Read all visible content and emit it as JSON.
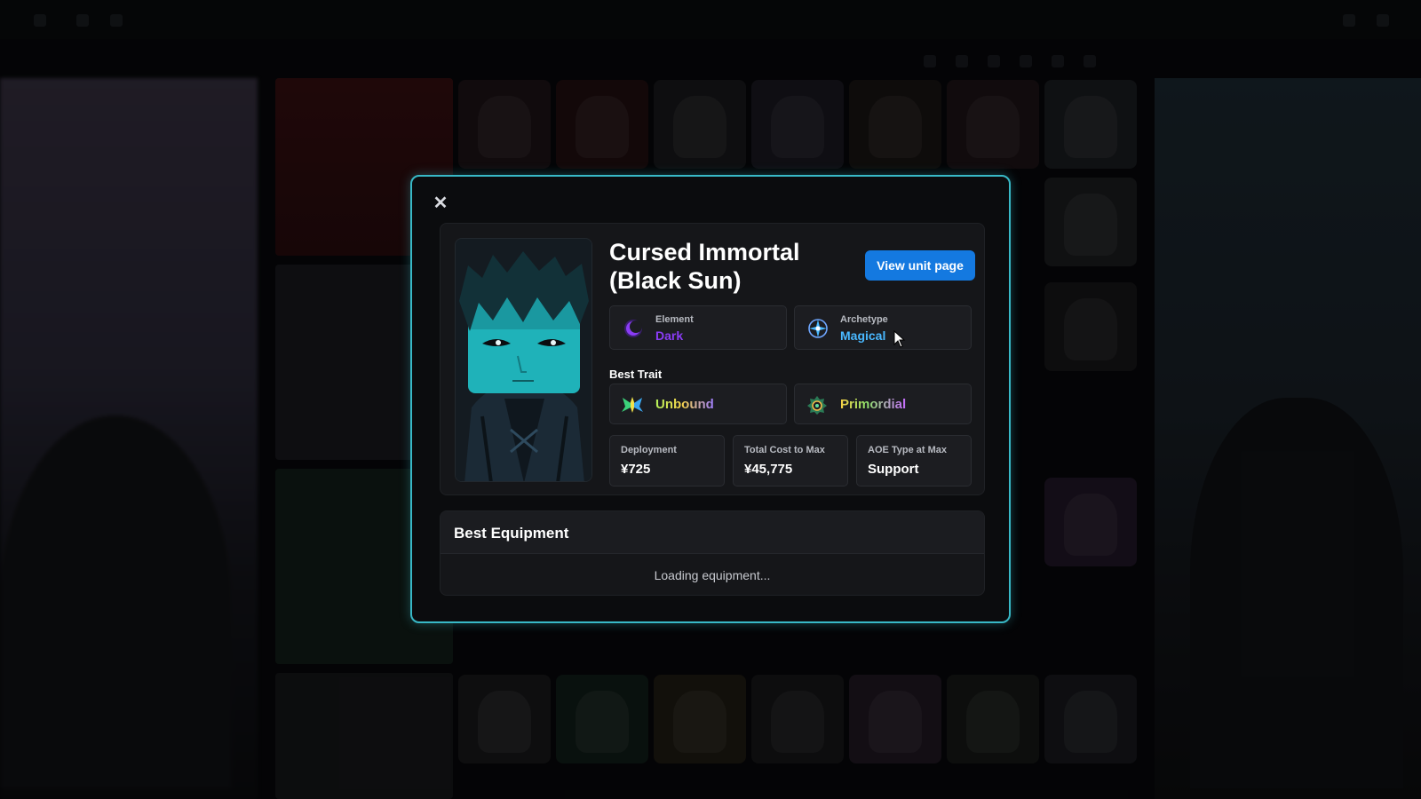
{
  "modal": {
    "close_symbol": "✕",
    "unit": {
      "name": "Cursed Immortal (Black Sun)",
      "view_button_label": "View unit page",
      "element": {
        "caption": "Element",
        "value": "Dark",
        "color": "#8a3cf5",
        "icon": "dark-moon-icon"
      },
      "archetype": {
        "caption": "Archetype",
        "value": "Magical",
        "color": "#49b8ff",
        "icon": "magic-star-icon"
      },
      "best_trait_label": "Best Trait",
      "traits": [
        {
          "value": "Unbound",
          "icon": "unbound-wings-icon"
        },
        {
          "value": "Primordial",
          "icon": "primordial-emblem-icon"
        }
      ],
      "stats": [
        {
          "caption": "Deployment",
          "value": "¥725"
        },
        {
          "caption": "Total Cost to Max",
          "value": "¥45,775"
        },
        {
          "caption": "AOE Type at Max",
          "value": "Support"
        }
      ]
    },
    "equipment": {
      "title": "Best Equipment",
      "status": "Loading equipment..."
    }
  },
  "theme": {
    "accent_border": "#38b8c6",
    "button_blue": "#1479e0"
  }
}
